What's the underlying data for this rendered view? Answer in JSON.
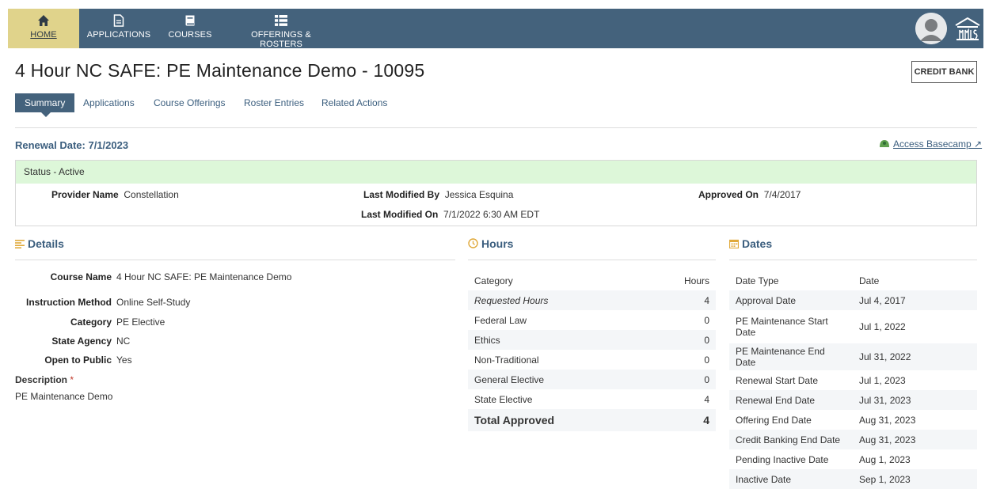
{
  "nav": {
    "home": "HOME",
    "applications": "APPLICATIONS",
    "courses": "COURSES",
    "offerings": "OFFERINGS & ROSTERS"
  },
  "page": {
    "title": "4 Hour NC SAFE: PE Maintenance Demo - 10095",
    "credit_bank": "CREDIT BANK"
  },
  "tabs": [
    "Summary",
    "Applications",
    "Course Offerings",
    "Roster Entries",
    "Related Actions"
  ],
  "renewal": "Renewal Date: 7/1/2023",
  "basecamp": "Access Basecamp ↗",
  "status": {
    "label": "Status - Active",
    "provider_name_label": "Provider Name",
    "provider_name": "Constellation",
    "last_modified_by_label": "Last Modified By",
    "last_modified_by": "Jessica Esquina",
    "last_modified_on_label": "Last Modified On",
    "last_modified_on": "7/1/2022 6:30 AM EDT",
    "approved_on_label": "Approved On",
    "approved_on": "7/4/2017"
  },
  "details": {
    "heading": "Details",
    "rows": [
      {
        "k": "Course Name",
        "v": "4 Hour NC SAFE: PE Maintenance Demo"
      },
      {
        "k": "Instruction Method",
        "v": "Online Self-Study"
      },
      {
        "k": "Category",
        "v": "PE Elective"
      },
      {
        "k": "State Agency",
        "v": "NC"
      },
      {
        "k": "Open to Public",
        "v": "Yes"
      }
    ],
    "description_label": "Description",
    "description_req": "*",
    "description": "PE Maintenance Demo"
  },
  "hours": {
    "heading": "Hours",
    "col1": "Category",
    "col2": "Hours",
    "rows": [
      {
        "c": "Requested Hours",
        "h": "4"
      },
      {
        "c": "Federal Law",
        "h": "0"
      },
      {
        "c": "Ethics",
        "h": "0"
      },
      {
        "c": "Non-Traditional",
        "h": "0"
      },
      {
        "c": "General Elective",
        "h": "0"
      },
      {
        "c": "State Elective",
        "h": "4"
      }
    ],
    "total_label": "Total Approved",
    "total": "4"
  },
  "dates": {
    "heading": "Dates",
    "col1": "Date Type",
    "col2": "Date",
    "rows": [
      {
        "t": "Approval Date",
        "d": "Jul 4, 2017"
      },
      {
        "t": "PE Maintenance Start Date",
        "d": "Jul 1, 2022"
      },
      {
        "t": "PE Maintenance End Date",
        "d": "Jul 31, 2022"
      },
      {
        "t": "Renewal Start Date",
        "d": "Jul 1, 2023"
      },
      {
        "t": "Renewal End Date",
        "d": "Jul 31, 2023"
      },
      {
        "t": "Offering End Date",
        "d": "Aug 31, 2023"
      },
      {
        "t": "Credit Banking End Date",
        "d": "Aug 31, 2023"
      },
      {
        "t": "Pending Inactive Date",
        "d": "Aug 1, 2023"
      },
      {
        "t": "Inactive Date",
        "d": "Sep 1, 2023"
      }
    ]
  },
  "colors": {
    "nav_bg": "#44627c",
    "nav_active": "#e0d38b",
    "accent": "#3b5e7e",
    "status_bg": "#ddf7d9",
    "section_icon": "#e0a93b"
  },
  "icons": {
    "home": "home-icon",
    "applications": "document-icon",
    "courses": "book-icon",
    "offerings": "list-icon",
    "details": "lines-icon",
    "hours": "clock-icon",
    "dates": "calendar-icon"
  }
}
